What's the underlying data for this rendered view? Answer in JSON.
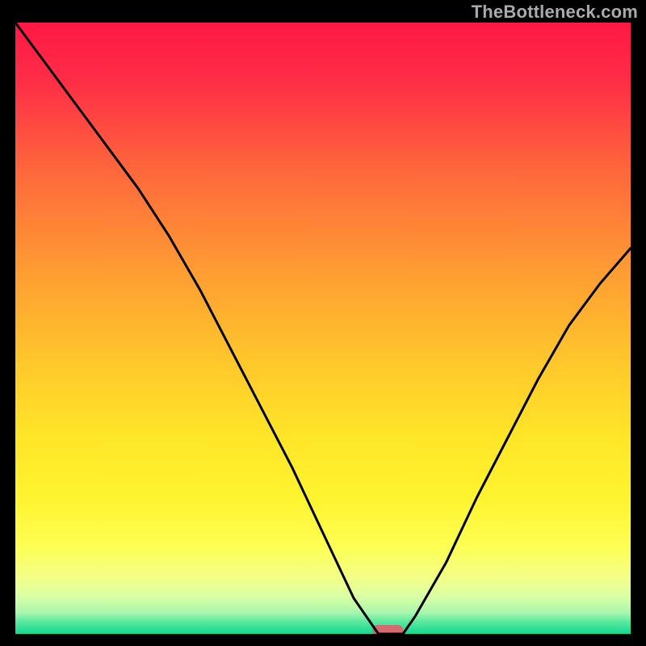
{
  "watermark": "TheBottleneck.com",
  "chart_data": {
    "type": "line",
    "title": "",
    "xlabel": "",
    "ylabel": "",
    "xlim": [
      0,
      100
    ],
    "ylim": [
      0,
      103
    ],
    "x": [
      0,
      5,
      10,
      15,
      20,
      25,
      30,
      35,
      40,
      45,
      50,
      55,
      59,
      61,
      63,
      65,
      70,
      75,
      80,
      85,
      90,
      95,
      100
    ],
    "values": [
      103,
      96,
      89,
      82,
      75,
      67,
      58,
      48,
      38,
      28,
      17,
      6,
      0,
      0,
      0,
      3,
      12,
      23,
      33,
      43,
      52,
      59,
      65
    ],
    "optimum_marker": {
      "x_start": 58,
      "x_end": 63,
      "y": 0
    },
    "grid": false,
    "legend": false
  }
}
